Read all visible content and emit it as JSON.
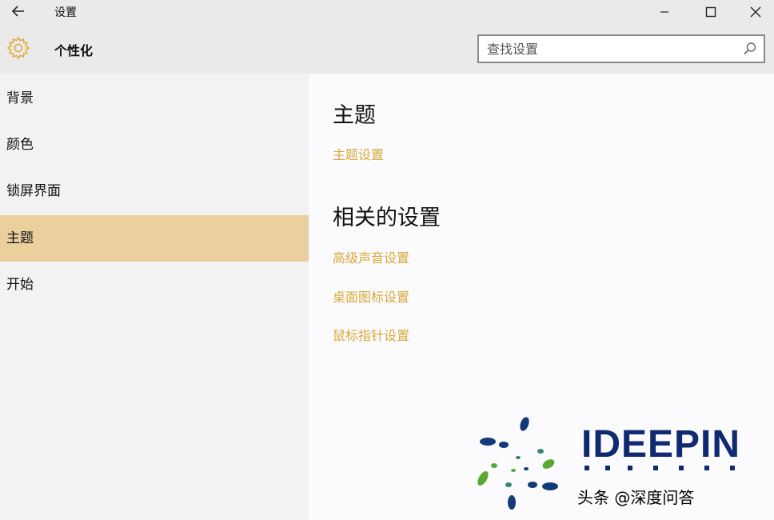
{
  "window": {
    "app_title": "设置",
    "controls": [
      "minimize-icon",
      "maximize-icon",
      "close-icon"
    ]
  },
  "header": {
    "page_title": "个性化",
    "icon": "gear-icon",
    "search_placeholder": "查找设置"
  },
  "sidebar": {
    "items": [
      {
        "label": "背景",
        "active": false
      },
      {
        "label": "颜色",
        "active": false
      },
      {
        "label": "锁屏界面",
        "active": false
      },
      {
        "label": "主题",
        "active": true
      },
      {
        "label": "开始",
        "active": false
      }
    ]
  },
  "content": {
    "theme_title": "主题",
    "theme_link": "主题设置",
    "related_title": "相关的设置",
    "related_links": [
      "高级声音设置",
      "桌面图标设置",
      "鼠标指针设置"
    ]
  },
  "watermark": {
    "brand": "IDEEPIN",
    "caption": "头条 @深度问答"
  },
  "colors": {
    "accent": "#ebd09e",
    "link": "#d9a93a",
    "chrome": "#eaeaea",
    "sidebar": "#f2f2f2"
  }
}
